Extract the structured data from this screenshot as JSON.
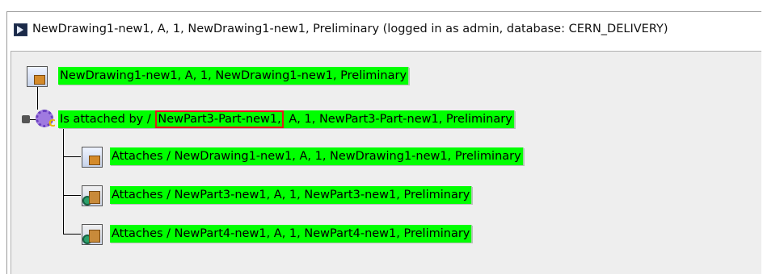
{
  "window": {
    "title": "NewDrawing1-new1, A, 1, NewDrawing1-new1, Preliminary (logged in as admin, database: CERN_DELIVERY)"
  },
  "tree": {
    "root": "NewDrawing1-new1, A, 1, NewDrawing1-new1, Preliminary",
    "child": {
      "prefix": "Is attached by / ",
      "highlighted": "NewPart3-Part-new1,",
      "suffix": " A, 1, NewPart3-Part-new1, Preliminary",
      "highlight_color": "#e21b1b"
    },
    "grandchildren": [
      {
        "label": "Attaches / NewDrawing1-new1, A, 1, NewDrawing1-new1, Preliminary",
        "icon": "drawing-icon"
      },
      {
        "label": "Attaches / NewPart3-new1, A, 1, NewPart3-new1, Preliminary",
        "icon": "part-document-icon"
      },
      {
        "label": "Attaches / NewPart4-new1, A, 1, NewPart4-new1, Preliminary",
        "icon": "part-document-icon"
      }
    ]
  },
  "colors": {
    "node_background": "#00ff00",
    "pane_background": "#eeeeee"
  }
}
